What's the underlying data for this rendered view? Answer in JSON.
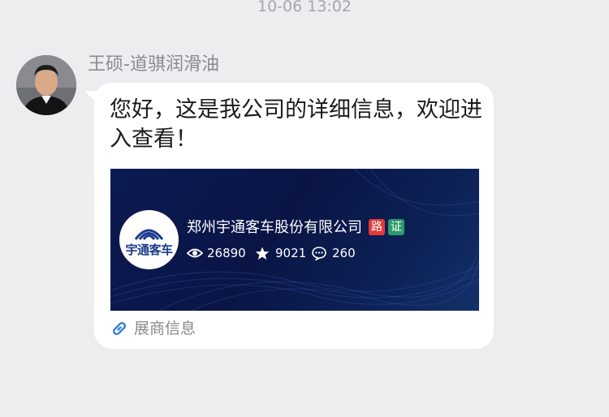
{
  "timestamp": "10-06 13:02",
  "sender": {
    "name": "王硕-道骐润滑油"
  },
  "message": {
    "text": "您好，这是我公司的详细信息，欢迎进入查看！"
  },
  "card": {
    "logo_text": "宇通客车",
    "company_name": "郑州宇通客车股份有限公司",
    "tags": [
      "路",
      "证"
    ],
    "stats": {
      "views": "26890",
      "stars": "9021",
      "comments": "260"
    },
    "footer_label": "展商信息"
  },
  "colors": {
    "background": "#ededf0",
    "bubble": "#ffffff",
    "card_bg": "#0b1a52",
    "tag_road": "#e23a3a",
    "tag_cert": "#2a9c6a",
    "link_icon": "#2f7fd6"
  }
}
